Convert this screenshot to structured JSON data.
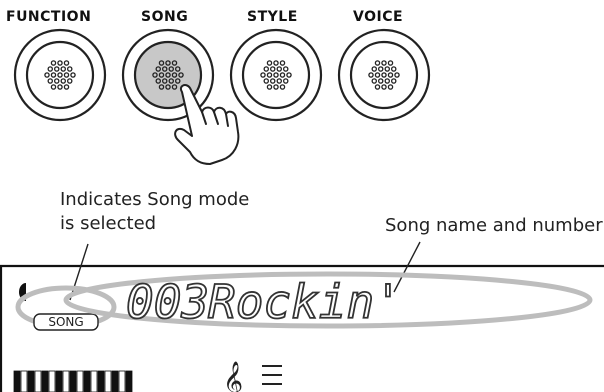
{
  "panel_buttons": [
    {
      "label": "FUNCTION"
    },
    {
      "label": "SONG",
      "state": "pressed"
    },
    {
      "label": "STYLE"
    },
    {
      "label": "VOICE"
    }
  ],
  "callouts": {
    "mode_indicator": "Indicates Song mode\nis selected",
    "song_name": "Song name and number"
  },
  "display": {
    "song_number": "003",
    "song_name": "Rockin'",
    "mode_badge": "SONG",
    "clef_icon": "treble-clef-icon",
    "menu_icon": "menu-lines-icon"
  },
  "colors": {
    "button_outline": "#222222",
    "pressed_fill": "#c8c8c8",
    "highlight_ellipse": "#bfbfbf",
    "lcd_text": "#333333"
  }
}
